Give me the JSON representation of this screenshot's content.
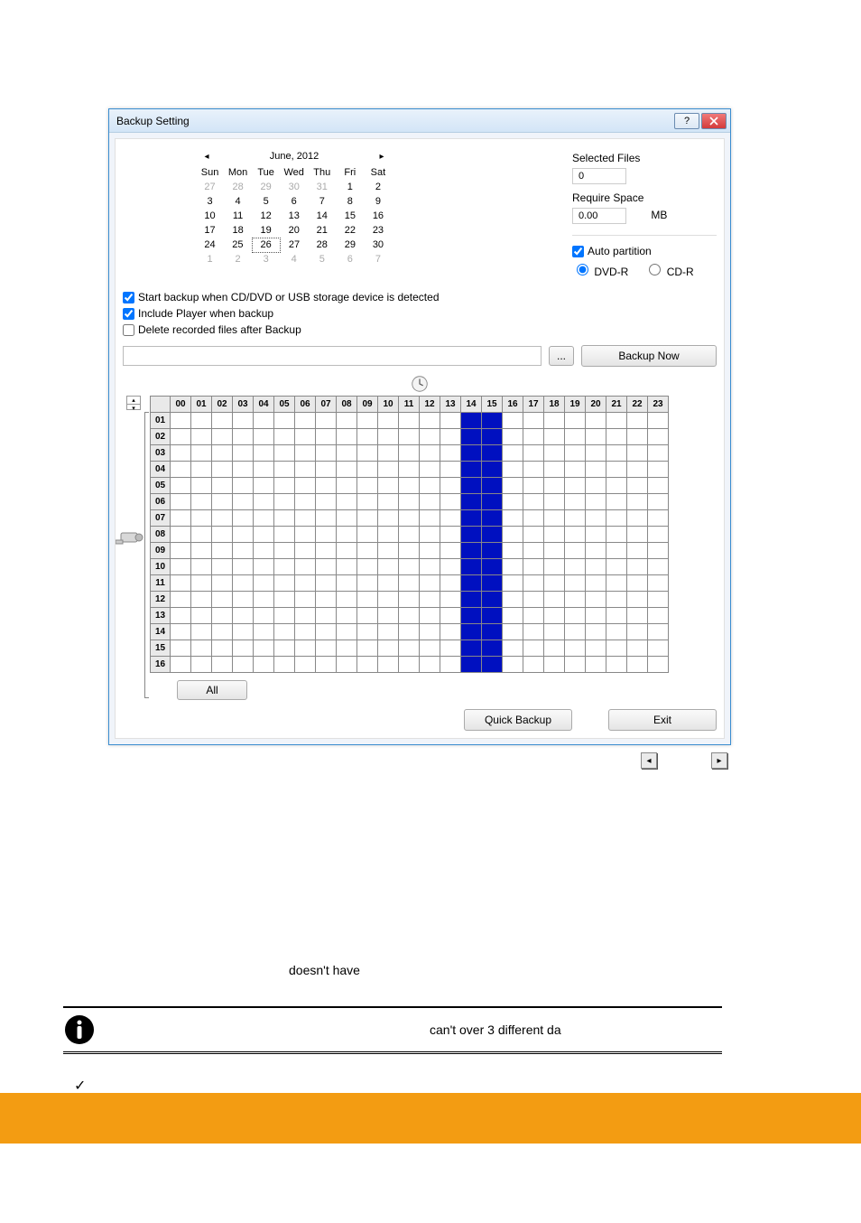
{
  "dialog": {
    "title": "Backup Setting",
    "calendar": {
      "month_label": "June, 2012",
      "dow": [
        "Sun",
        "Mon",
        "Tue",
        "Wed",
        "Thu",
        "Fri",
        "Sat"
      ],
      "weeks": [
        [
          {
            "n": 27,
            "other": true
          },
          {
            "n": 28,
            "other": true
          },
          {
            "n": 29,
            "other": true
          },
          {
            "n": 30,
            "other": true
          },
          {
            "n": 31,
            "other": true
          },
          {
            "n": 1
          },
          {
            "n": 2
          }
        ],
        [
          {
            "n": 3
          },
          {
            "n": 4
          },
          {
            "n": 5
          },
          {
            "n": 6
          },
          {
            "n": 7
          },
          {
            "n": 8
          },
          {
            "n": 9
          }
        ],
        [
          {
            "n": 10
          },
          {
            "n": 11
          },
          {
            "n": 12
          },
          {
            "n": 13
          },
          {
            "n": 14
          },
          {
            "n": 15
          },
          {
            "n": 16
          }
        ],
        [
          {
            "n": 17
          },
          {
            "n": 18
          },
          {
            "n": 19
          },
          {
            "n": 20
          },
          {
            "n": 21
          },
          {
            "n": 22
          },
          {
            "n": 23
          }
        ],
        [
          {
            "n": 24
          },
          {
            "n": 25
          },
          {
            "n": 26,
            "selected": true
          },
          {
            "n": 27
          },
          {
            "n": 28
          },
          {
            "n": 29
          },
          {
            "n": 30
          }
        ],
        [
          {
            "n": 1,
            "other": true
          },
          {
            "n": 2,
            "other": true
          },
          {
            "n": 3,
            "other": true
          },
          {
            "n": 4,
            "other": true
          },
          {
            "n": 5,
            "other": true
          },
          {
            "n": 6,
            "other": true
          },
          {
            "n": 7,
            "other": true
          }
        ]
      ]
    },
    "right": {
      "selected_label": "Selected Files",
      "selected_value": "0",
      "require_label": "Require Space",
      "require_value": "0.00",
      "require_unit": "MB",
      "auto_partition_label": "Auto partition",
      "auto_partition_checked": true,
      "dvd_label": "DVD-R",
      "cd_label": "CD-R",
      "media_selected": "dvd"
    },
    "options": {
      "opt1": {
        "label": "Start backup when CD/DVD or USB storage device is detected",
        "checked": true
      },
      "opt2": {
        "label": "Include Player when backup",
        "checked": true
      },
      "opt3": {
        "label": "Delete recorded files after Backup",
        "checked": false
      }
    },
    "buttons": {
      "browse": "...",
      "backup_now": "Backup Now",
      "all": "All",
      "quick_backup": "Quick Backup",
      "exit": "Exit"
    },
    "schedule": {
      "hours": [
        "00",
        "01",
        "02",
        "03",
        "04",
        "05",
        "06",
        "07",
        "08",
        "09",
        "10",
        "11",
        "12",
        "13",
        "14",
        "15",
        "16",
        "17",
        "18",
        "19",
        "20",
        "21",
        "22",
        "23"
      ],
      "rows": [
        "01",
        "02",
        "03",
        "04",
        "05",
        "06",
        "07",
        "08",
        "09",
        "10",
        "11",
        "12",
        "13",
        "14",
        "15",
        "16"
      ],
      "selected_cols": [
        14,
        15
      ]
    }
  },
  "fragments": {
    "f1": "doesn't have",
    "f2": "can't over 3 different da"
  }
}
